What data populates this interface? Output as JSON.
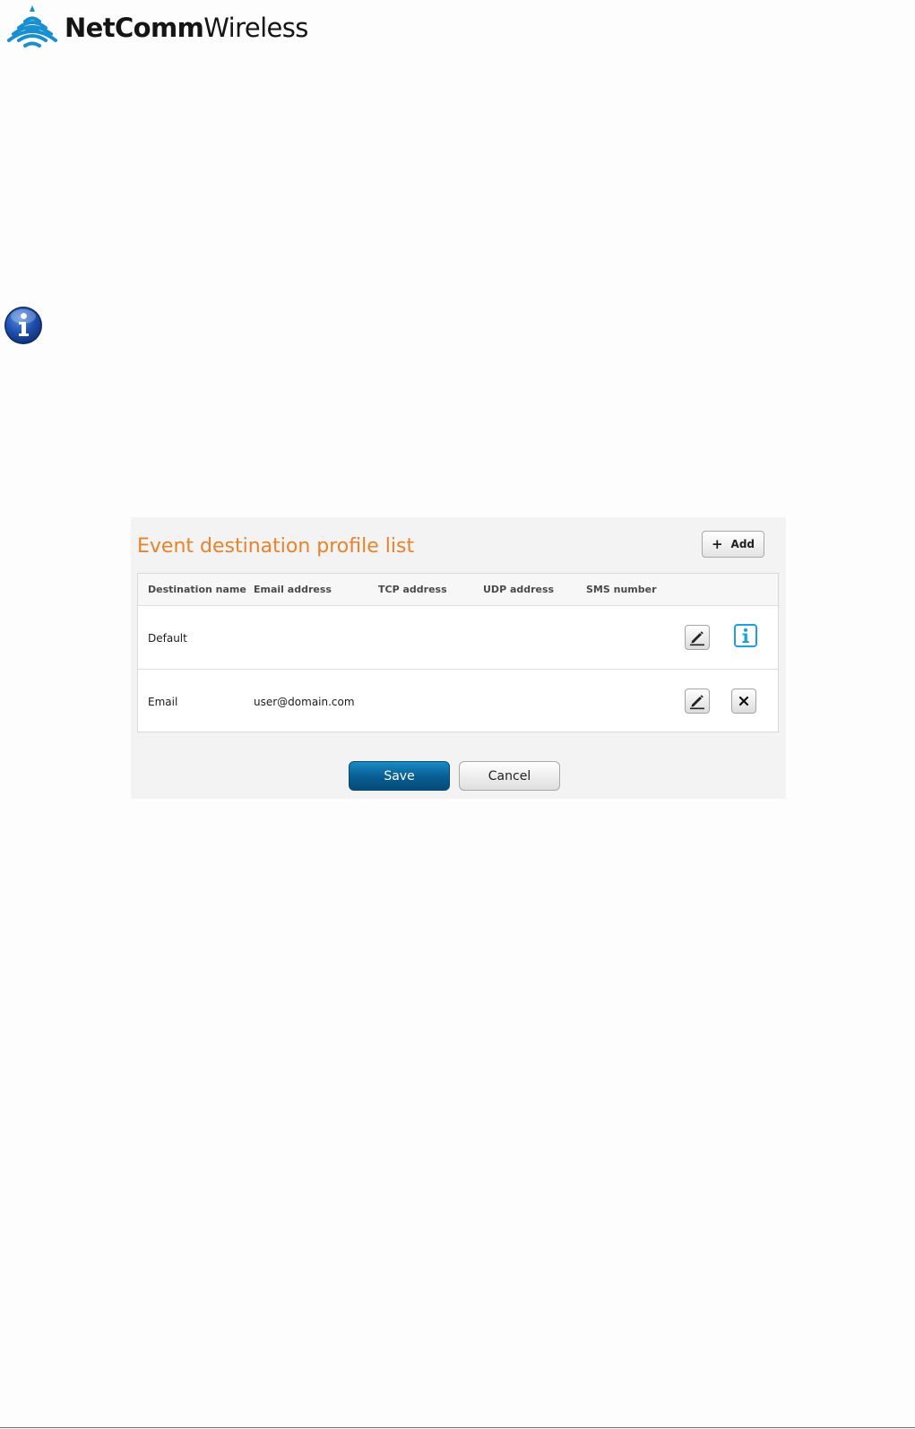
{
  "logo": {
    "text_bold": "NetComm",
    "text_light": "Wireless",
    "icon": "wifi-signal-logo-icon"
  },
  "note": {
    "icon": "info-note-icon"
  },
  "panel": {
    "title": "Event destination profile list",
    "add_button_label": "Add",
    "add_button_icon": "plus-icon",
    "columns": [
      "Destination name",
      "Email address",
      "TCP address",
      "UDP address",
      "SMS number"
    ],
    "rows": [
      {
        "destination_name": "Default",
        "email_address": "",
        "tcp_address": "",
        "udp_address": "",
        "sms_number": "",
        "actions": [
          "edit-icon",
          "info-icon"
        ]
      },
      {
        "destination_name": "Email",
        "email_address": "user@domain.com",
        "tcp_address": "",
        "udp_address": "",
        "sms_number": "",
        "actions": [
          "edit-icon",
          "delete-icon"
        ]
      }
    ],
    "save_label": "Save",
    "cancel_label": "Cancel"
  },
  "colors": {
    "title_orange": "#e8832a",
    "logo_blue": "#1a8fd0",
    "save_blue": "#075d92",
    "info_blue": "#1aa0dc",
    "panel_bg": "#f3f3f3"
  }
}
